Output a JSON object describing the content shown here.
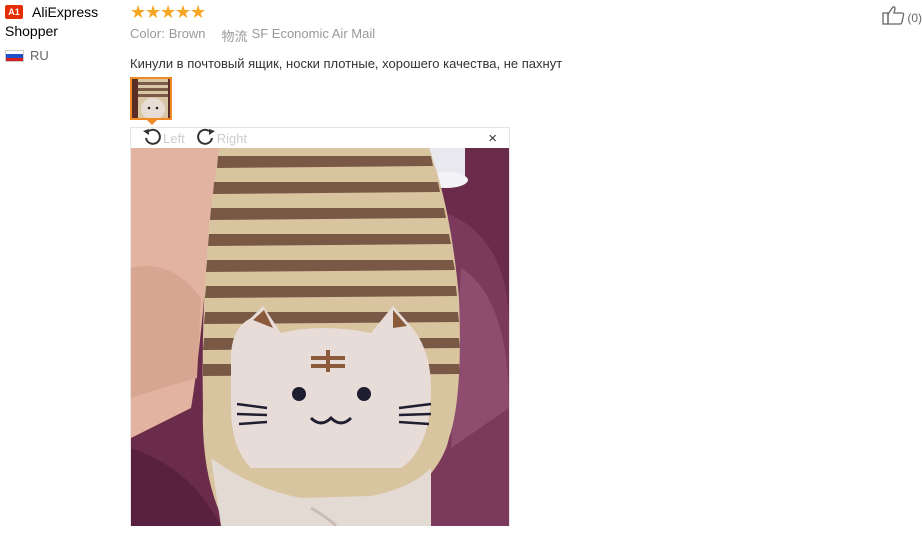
{
  "user": {
    "badge": "A1",
    "name_line1": "AliExpress",
    "name_line2": "Shopper",
    "country": "RU"
  },
  "review": {
    "rating": 5,
    "color_label": "Color:",
    "color_value": "Brown",
    "logistics_label": "物流",
    "logistics_value": "SF Economic Air Mail",
    "comment": "Кинули в почтовый ящик, носки плотные, хорошего качества, не пахнут"
  },
  "viewer": {
    "rotate_left_label": "Left",
    "rotate_right_label": "Right",
    "close_symbol": "×"
  },
  "helpful": {
    "count": "(0)"
  },
  "colors": {
    "star": "#f5a623",
    "badge": "#e62e04",
    "thumb_border": "#f08a24"
  }
}
